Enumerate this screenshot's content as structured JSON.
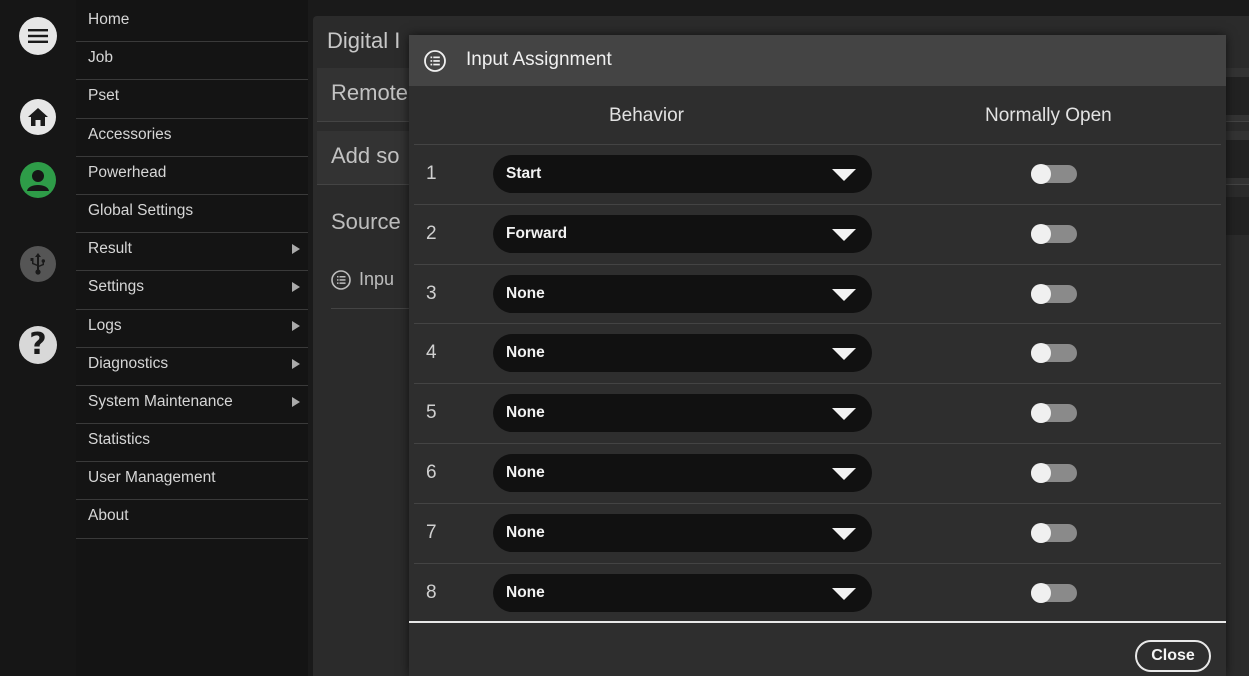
{
  "nav": {
    "items": [
      {
        "label": "Home",
        "has_submenu": false
      },
      {
        "label": "Job",
        "has_submenu": false
      },
      {
        "label": "Pset",
        "has_submenu": false
      },
      {
        "label": "Accessories",
        "has_submenu": false
      },
      {
        "label": "Powerhead",
        "has_submenu": false
      },
      {
        "label": "Global Settings",
        "has_submenu": false
      },
      {
        "label": "Result",
        "has_submenu": true
      },
      {
        "label": "Settings",
        "has_submenu": true
      },
      {
        "label": "Logs",
        "has_submenu": true
      },
      {
        "label": "Diagnostics",
        "has_submenu": true
      },
      {
        "label": "System Maintenance",
        "has_submenu": true
      },
      {
        "label": "Statistics",
        "has_submenu": false
      },
      {
        "label": "User Management",
        "has_submenu": false
      },
      {
        "label": "About",
        "has_submenu": false
      }
    ]
  },
  "rail": {
    "icons": [
      "menu-icon",
      "home-icon",
      "user-icon",
      "usb-icon",
      "help-icon"
    ],
    "help_glyph": "?",
    "user_color": "#2e9c48"
  },
  "background_page": {
    "title": "Digital I",
    "row_remote": "Remote",
    "row_add": "Add so",
    "source_label": "Source",
    "input_label": "Inpu"
  },
  "dialog": {
    "title": "Input Assignment",
    "col_behavior": "Behavior",
    "col_normally_open": "Normally Open",
    "close_label": "Close",
    "rows": [
      {
        "num": "1",
        "behavior": "Start",
        "normally_open": false
      },
      {
        "num": "2",
        "behavior": "Forward",
        "normally_open": false
      },
      {
        "num": "3",
        "behavior": "None",
        "normally_open": false
      },
      {
        "num": "4",
        "behavior": "None",
        "normally_open": false
      },
      {
        "num": "5",
        "behavior": "None",
        "normally_open": false
      },
      {
        "num": "6",
        "behavior": "None",
        "normally_open": false
      },
      {
        "num": "7",
        "behavior": "None",
        "normally_open": false
      },
      {
        "num": "8",
        "behavior": "None",
        "normally_open": false
      }
    ]
  }
}
